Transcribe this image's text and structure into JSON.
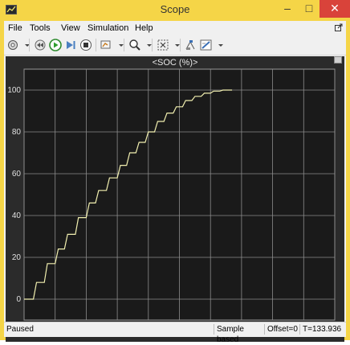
{
  "window": {
    "title": "Scope"
  },
  "menu": {
    "items": [
      "File",
      "Tools",
      "View",
      "Simulation",
      "Help"
    ]
  },
  "toolbar": {
    "icons": [
      "gear-icon",
      "rewind-icon",
      "run-icon",
      "step-forward-icon",
      "stop-icon",
      "highlight-icon",
      "zoom-icon",
      "autoscale-icon",
      "cursor-measure-icon",
      "style-icon"
    ]
  },
  "plot": {
    "title": "<SOC (%)>"
  },
  "status": {
    "state": "Paused",
    "mode": "Sample based",
    "offset": "Offset=0",
    "time": "T=133.936"
  },
  "chart_data": {
    "type": "line",
    "title": "<SOC (%)>",
    "xlabel": "",
    "ylabel": "",
    "xlim": [
      0,
      200
    ],
    "ylim": [
      -10,
      110
    ],
    "xticks": [
      0,
      20,
      40,
      60,
      80,
      100,
      120,
      140,
      160,
      180,
      200
    ],
    "yticks": [
      0,
      20,
      40,
      60,
      80,
      100
    ],
    "grid": true,
    "colors": {
      "background": "#1a1a1a",
      "grid": "#8c8c8c",
      "line": "#f2f0b0",
      "axis_text": "#e0e0e0"
    },
    "series": [
      {
        "x": [
          0,
          6,
          8,
          13,
          15,
          20,
          22,
          26,
          28,
          33,
          35,
          40,
          42,
          46,
          48,
          53,
          55,
          60,
          62,
          66,
          68,
          72,
          74,
          78,
          80,
          84,
          86,
          90,
          92,
          96,
          98,
          102,
          104,
          108,
          110,
          114,
          116,
          120,
          122,
          126,
          128,
          133.9
        ],
        "y": [
          0,
          0,
          8,
          8,
          17,
          17,
          24,
          24,
          31,
          31,
          39,
          39,
          46,
          46,
          52,
          52,
          58,
          58,
          64,
          64,
          70,
          70,
          75,
          75,
          80,
          80,
          85,
          85,
          89,
          89,
          92,
          92,
          95,
          95,
          97,
          97,
          98.5,
          98.5,
          99.5,
          99.5,
          100,
          100
        ]
      }
    ]
  }
}
